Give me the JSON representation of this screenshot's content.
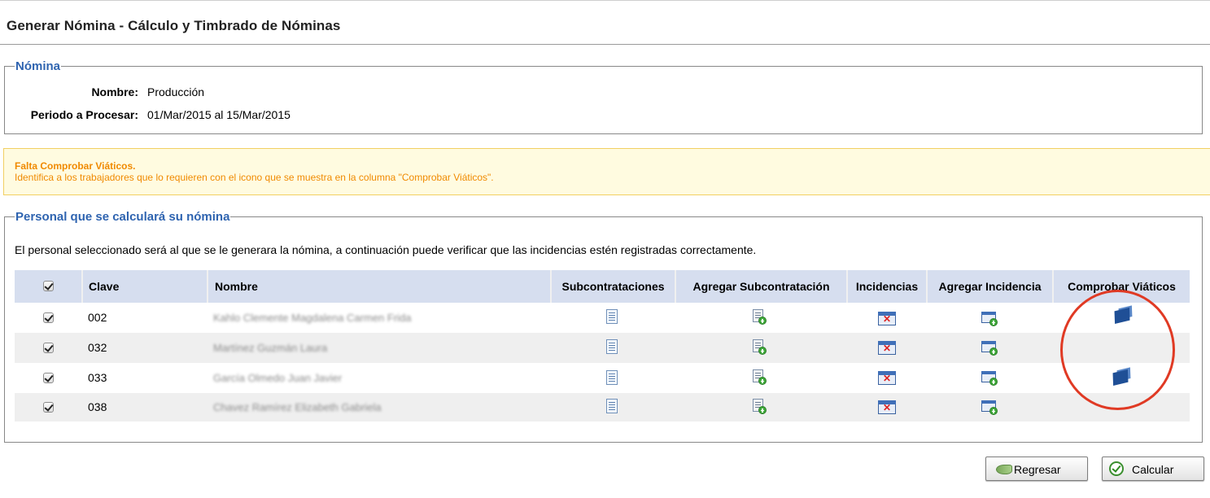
{
  "header": {
    "title": "Generar Nómina - Cálculo y Timbrado de Nóminas"
  },
  "nomina": {
    "legend": "Nómina",
    "nombre_label": "Nombre:",
    "nombre_value": "Producción",
    "periodo_label": "Periodo a Procesar:",
    "periodo_value": "01/Mar/2015 al 15/Mar/2015"
  },
  "warning": {
    "title": "Falta Comprobar Viáticos.",
    "text": "Identifica a los trabajadores que lo requieren con el icono que se muestra en la columna \"Comprobar Viáticos\".",
    "color": "#f08a00"
  },
  "personal": {
    "legend": "Personal que se calculará su nómina",
    "description": "El personal seleccionado será al que se le generara la nómina, a continuación puede verificar que las incidencias estén registradas correctamente.",
    "columns": {
      "select_all_checked": true,
      "clave": "Clave",
      "nombre": "Nombre",
      "subcontrataciones": "Subcontrataciones",
      "agregar_subcontratacion": "Agregar Subcontratación",
      "incidencias": "Incidencias",
      "agregar_incidencia": "Agregar Incidencia",
      "comprobar_viaticos": "Comprobar Viáticos"
    },
    "rows": [
      {
        "checked": true,
        "clave": "002",
        "nombre": "Kahlo Clemente Magdalena Carmen Frida",
        "viaticos": true
      },
      {
        "checked": true,
        "clave": "032",
        "nombre": "Martínez Guzmán Laura",
        "viaticos": false
      },
      {
        "checked": true,
        "clave": "033",
        "nombre": "García Olmedo Juan Javier",
        "viaticos": true
      },
      {
        "checked": true,
        "clave": "038",
        "nombre": "Chavez Ramírez Elizabeth Gabriela",
        "viaticos": false
      }
    ],
    "icons": {
      "subcontrataciones": "document-icon",
      "agregar_subcontratacion": "document-add-icon",
      "incidencias": "calendar-delete-icon",
      "agregar_incidencia": "calendar-add-icon",
      "comprobar_viaticos": "viaticos-receipt-icon"
    }
  },
  "buttons": {
    "regresar": "Regresar",
    "calcular": "Calcular"
  },
  "colors": {
    "accent": "#2f64b0",
    "header_bg": "#d6deef",
    "highlight_circle": "#e03a24"
  }
}
